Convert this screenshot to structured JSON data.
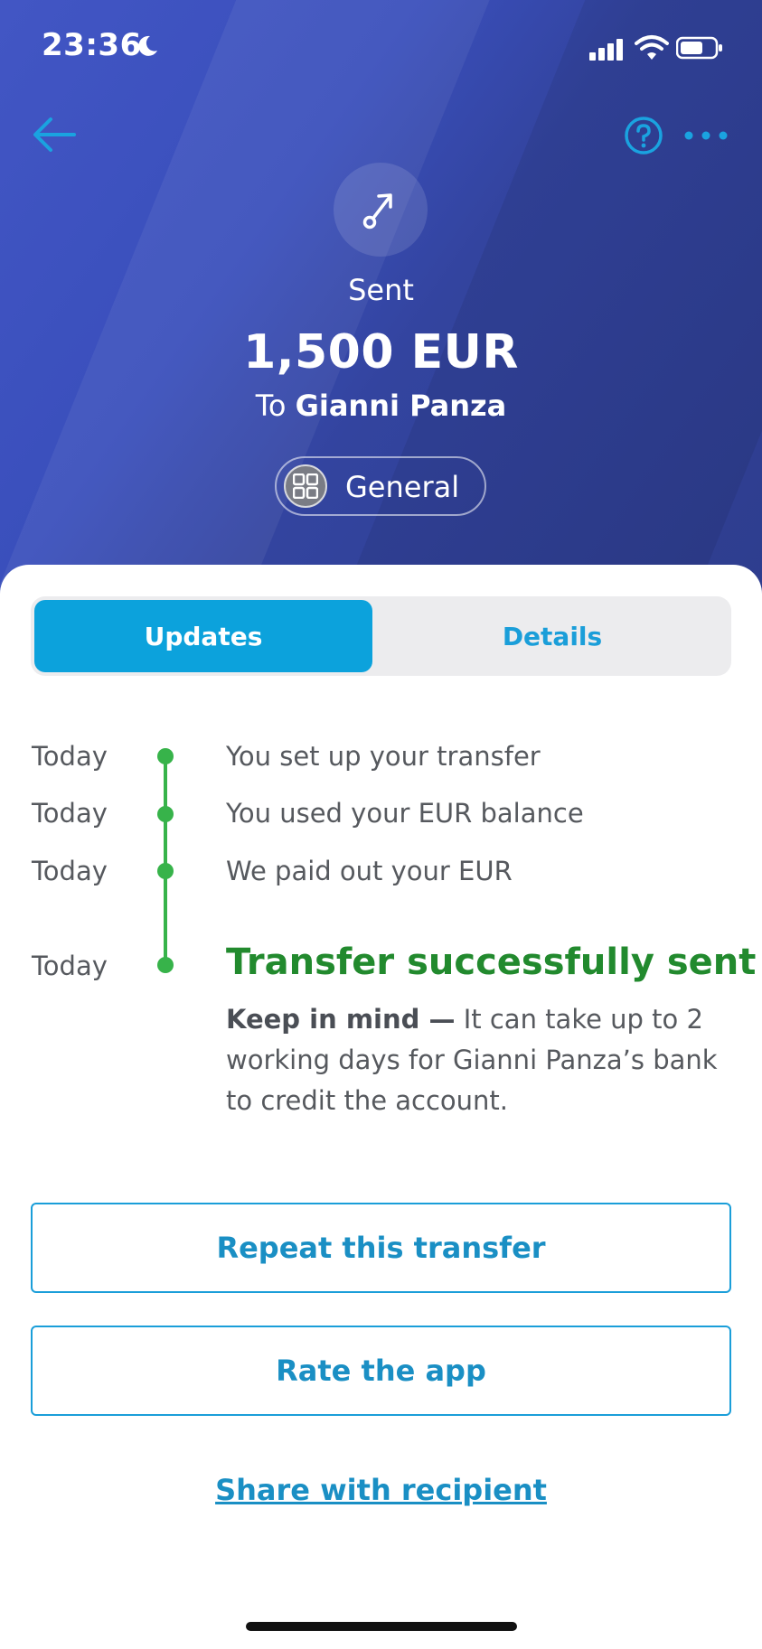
{
  "status_bar": {
    "time": "23:36"
  },
  "header": {
    "status": "Sent",
    "amount": "1,500 EUR",
    "recipient_prefix": "To",
    "recipient_name": "Gianni Panza",
    "account_label": "General"
  },
  "tabs": [
    {
      "label": "Updates",
      "active": true
    },
    {
      "label": "Details",
      "active": false
    }
  ],
  "timeline": [
    {
      "date": "Today",
      "text": "You set up your transfer"
    },
    {
      "date": "Today",
      "text": "You used your EUR balance"
    },
    {
      "date": "Today",
      "text": "We paid out your EUR"
    },
    {
      "date": "Today",
      "text": "Transfer successfully sent"
    }
  ],
  "note": {
    "bold": "Keep in mind —",
    "text": "It can take up to 2 working days for Gianni Panza’s bank to credit the account."
  },
  "actions": {
    "repeat": "Repeat this transfer",
    "rate": "Rate the app",
    "share": "Share with recipient"
  },
  "colors": {
    "header_blue": "#3a4fbc",
    "accent_blue": "#0ca2dc",
    "success_green": "#228a2e",
    "timeline_green": "#37b34a"
  },
  "icons": [
    "moon-icon",
    "signal-icon",
    "wifi-icon",
    "battery-icon",
    "back-arrow-icon",
    "help-icon",
    "more-icon",
    "transfer-sent-icon",
    "grid-icon"
  ]
}
